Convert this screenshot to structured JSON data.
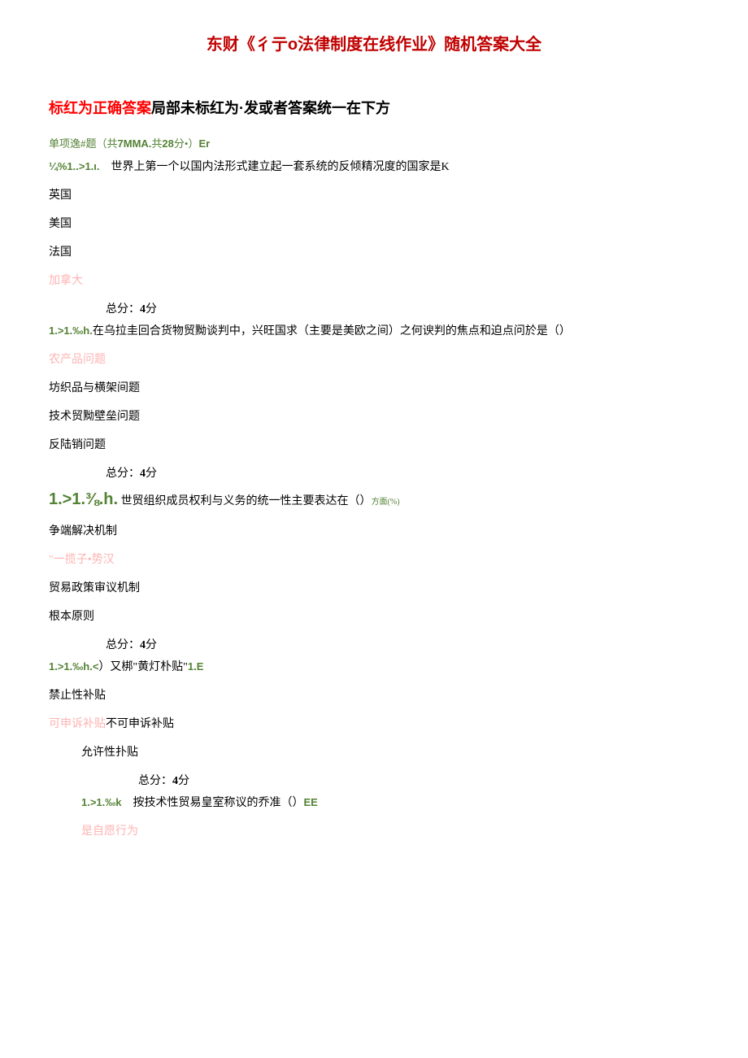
{
  "title": "东财《彳亍o法律制度在线作业》随机答案大全",
  "notice": {
    "red": "标红为正确答案",
    "black": "局部未标红为·发或者答案统一在下方"
  },
  "section_header": {
    "prefix": "单项逸#题（共",
    "num": "7MMA.",
    "mid": "共",
    "pts": "28",
    "suffix": "分•）",
    "tail": "Er"
  },
  "q1": {
    "num": "¼%1..>1.ι.",
    "text": "世界上第一个以国内法形式建立起一套系统的反倾精况度的国家是",
    "tail": "K",
    "opts": [
      "英国",
      "美国",
      "法国",
      "加拿大"
    ],
    "correct_idx": 3,
    "score": "总分：4分"
  },
  "q2": {
    "num": "1.>1.‰h.",
    "text": "在乌拉圭回合货物贸黝谈判中，兴旺国求（主要是美欧之间）之何谀判的焦点和迫点问於是（）",
    "opts": [
      "农产品问题",
      "坊织品与横架间题",
      "技术贸黝壁垒问题",
      "反陆销问题"
    ],
    "correct_idx": 0,
    "score": "总分：4分"
  },
  "q3": {
    "num": "1.>1.⅜.h.",
    "text": "世贸组织成员权利与义务的统一性主要表达在（）",
    "tail": "方面(%)",
    "opts": [
      "争端解决机制",
      "\"一揽子•势汉",
      "贸易政策审议机制",
      "根本原则"
    ],
    "correct_idx": 1,
    "score": "总分：4分"
  },
  "q4": {
    "num": "1.>1.‰h.<",
    "text": "）又梆\"黄灯朴贴\"",
    "tail": "1.E",
    "opts": [
      "禁止性补贴"
    ],
    "mixed": {
      "correct": "可申诉补贴",
      "rest": "不可申诉补贴"
    },
    "opt_indent": "允许性扑贴",
    "score": "总分：4分"
  },
  "q5": {
    "num": "1.>1.‰k",
    "text": "按技术性贸易皇室称议的乔准（）",
    "tail": "EE",
    "opts": [
      "是自愿行为"
    ],
    "correct_idx": 0
  }
}
